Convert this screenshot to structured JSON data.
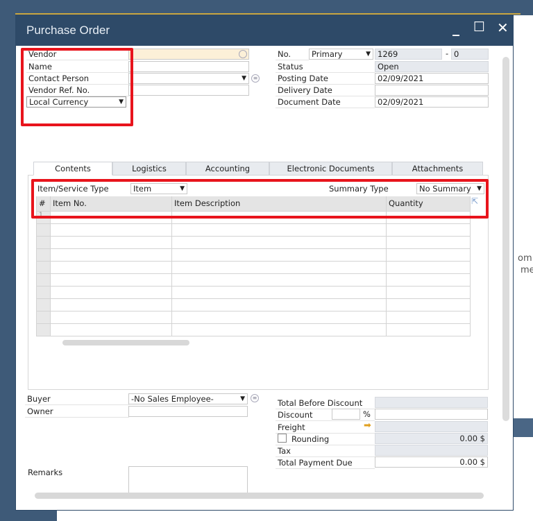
{
  "window": {
    "title": "Purchase Order",
    "minimize": "_",
    "maximize": "☐",
    "close": "✕"
  },
  "header_left": {
    "vendor": "Vendor",
    "name": "Name",
    "contact_person": "Contact Person",
    "vendor_ref": "Vendor Ref. No.",
    "currency": "Local Currency"
  },
  "header_right": {
    "no_label": "No.",
    "series": "Primary",
    "number": "1269",
    "suffix_sep": "-",
    "suffix": "0",
    "status_label": "Status",
    "status": "Open",
    "posting_date_label": "Posting Date",
    "posting_date": "02/09/2021",
    "delivery_date_label": "Delivery Date",
    "delivery_date": "",
    "document_date_label": "Document Date",
    "document_date": "02/09/2021"
  },
  "tabs": [
    {
      "label": "Contents"
    },
    {
      "label": "Logistics"
    },
    {
      "label": "Accounting"
    },
    {
      "label": "Electronic Documents"
    },
    {
      "label": "Attachments"
    }
  ],
  "contents": {
    "item_service_type_label": "Item/Service Type",
    "item_service_type": "Item",
    "summary_type_label": "Summary Type",
    "summary_type": "No Summary",
    "columns": [
      "#",
      "Item No.",
      "Item Description",
      "Quantity"
    ],
    "first_row_number": "1"
  },
  "footer_left": {
    "buyer_label": "Buyer",
    "buyer": "-No Sales Employee-",
    "owner_label": "Owner",
    "owner": "",
    "remarks_label": "Remarks"
  },
  "totals": {
    "total_before_discount_label": "Total Before Discount",
    "discount_label": "Discount",
    "percent": "%",
    "freight_label": "Freight",
    "rounding_label": "Rounding",
    "rounding_checked": false,
    "rounding_value": "0.00 $",
    "tax_label": "Tax",
    "total_payment_due_label": "Total Payment Due",
    "total_payment_due": "0.00 $"
  },
  "background": {
    "text1": "om",
    "text2": "me"
  },
  "colors": {
    "titlebar": "#2e4a68",
    "highlight": "#e8141c",
    "accent": "#c9a640"
  }
}
